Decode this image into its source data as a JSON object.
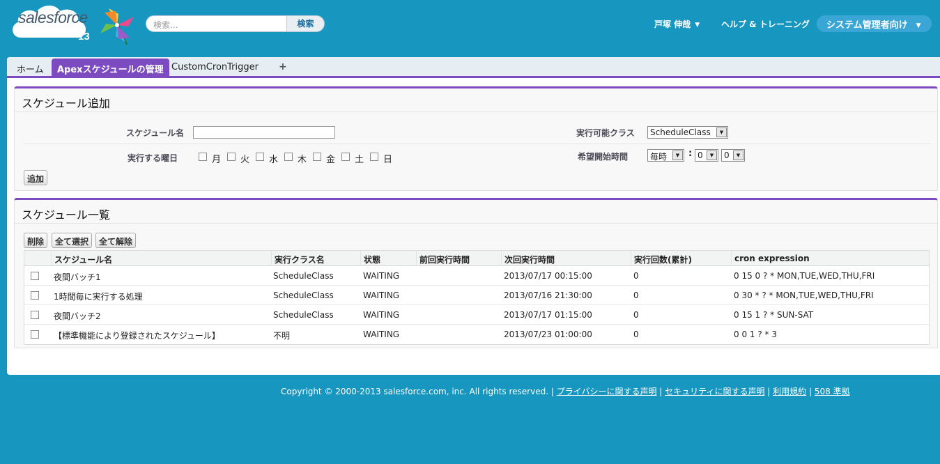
{
  "header": {
    "logo_text": "salesforce",
    "logo_version": "13",
    "search_placeholder": "検索...",
    "search_button": "検索",
    "user_name": "戸塚 伸哉",
    "help_link": "ヘルプ & トレーニング",
    "app_menu": "システム管理者向け"
  },
  "tabs": [
    {
      "label": "ホーム"
    },
    {
      "label": "Apexスケジュールの管理"
    },
    {
      "label": "CustomCronTrigger"
    }
  ],
  "tab_plus": "+",
  "add_section": {
    "title": "スケジュール追加",
    "schedule_name_label": "スケジュール名",
    "schedule_name_value": "",
    "class_label": "実行可能クラス",
    "class_value": "ScheduleClass",
    "weekday_label": "実行する曜日",
    "weekdays": [
      "月",
      "火",
      "水",
      "木",
      "金",
      "土",
      "日"
    ],
    "start_time_label": "希望開始時間",
    "hour_value": "毎時",
    "colon": ":",
    "minute_value": "0",
    "second_value": "0",
    "add_button": "追加"
  },
  "list_section": {
    "title": "スケジュール一覧",
    "buttons": {
      "delete": "削除",
      "select_all": "全て選択",
      "deselect_all": "全て解除"
    },
    "columns": [
      "スケジュール名",
      "実行クラス名",
      "状態",
      "前回実行時間",
      "次回実行時間",
      "実行回数(累計)",
      "cron expression"
    ],
    "rows": [
      {
        "name": "夜間バッチ1",
        "class": "ScheduleClass",
        "state": "WAITING",
        "prev": "",
        "next": "2013/07/17 00:15:00",
        "count": "0",
        "cron": "0 15 0 ? * MON,TUE,WED,THU,FRI"
      },
      {
        "name": "1時間毎に実行する処理",
        "class": "ScheduleClass",
        "state": "WAITING",
        "prev": "",
        "next": "2013/07/16 21:30:00",
        "count": "0",
        "cron": "0 30 * ? * MON,TUE,WED,THU,FRI"
      },
      {
        "name": "夜間バッチ2",
        "class": "ScheduleClass",
        "state": "WAITING",
        "prev": "",
        "next": "2013/07/17 01:15:00",
        "count": "0",
        "cron": "0 15 1 ? * SUN-SAT"
      },
      {
        "name": "【標準機能により登録されたスケジュール】",
        "class": "不明",
        "state": "WAITING",
        "prev": "",
        "next": "2013/07/23 01:00:00",
        "count": "0",
        "cron": "0 0 1 ? * 3"
      }
    ]
  },
  "footer": {
    "copyright": "Copyright © 2000-2013 salesforce.com, inc. All rights reserved. |",
    "privacy": "プライバシーに関する声明",
    "sep1": "|",
    "security": "セキュリティに関する声明",
    "sep2": "|",
    "terms": "利用規約",
    "sep3": "|",
    "compliance": "508 準拠"
  },
  "colors": {
    "background": "#1797c0",
    "tab_accent": "#7b4bbf",
    "app_menu": "#3aa6d6"
  }
}
